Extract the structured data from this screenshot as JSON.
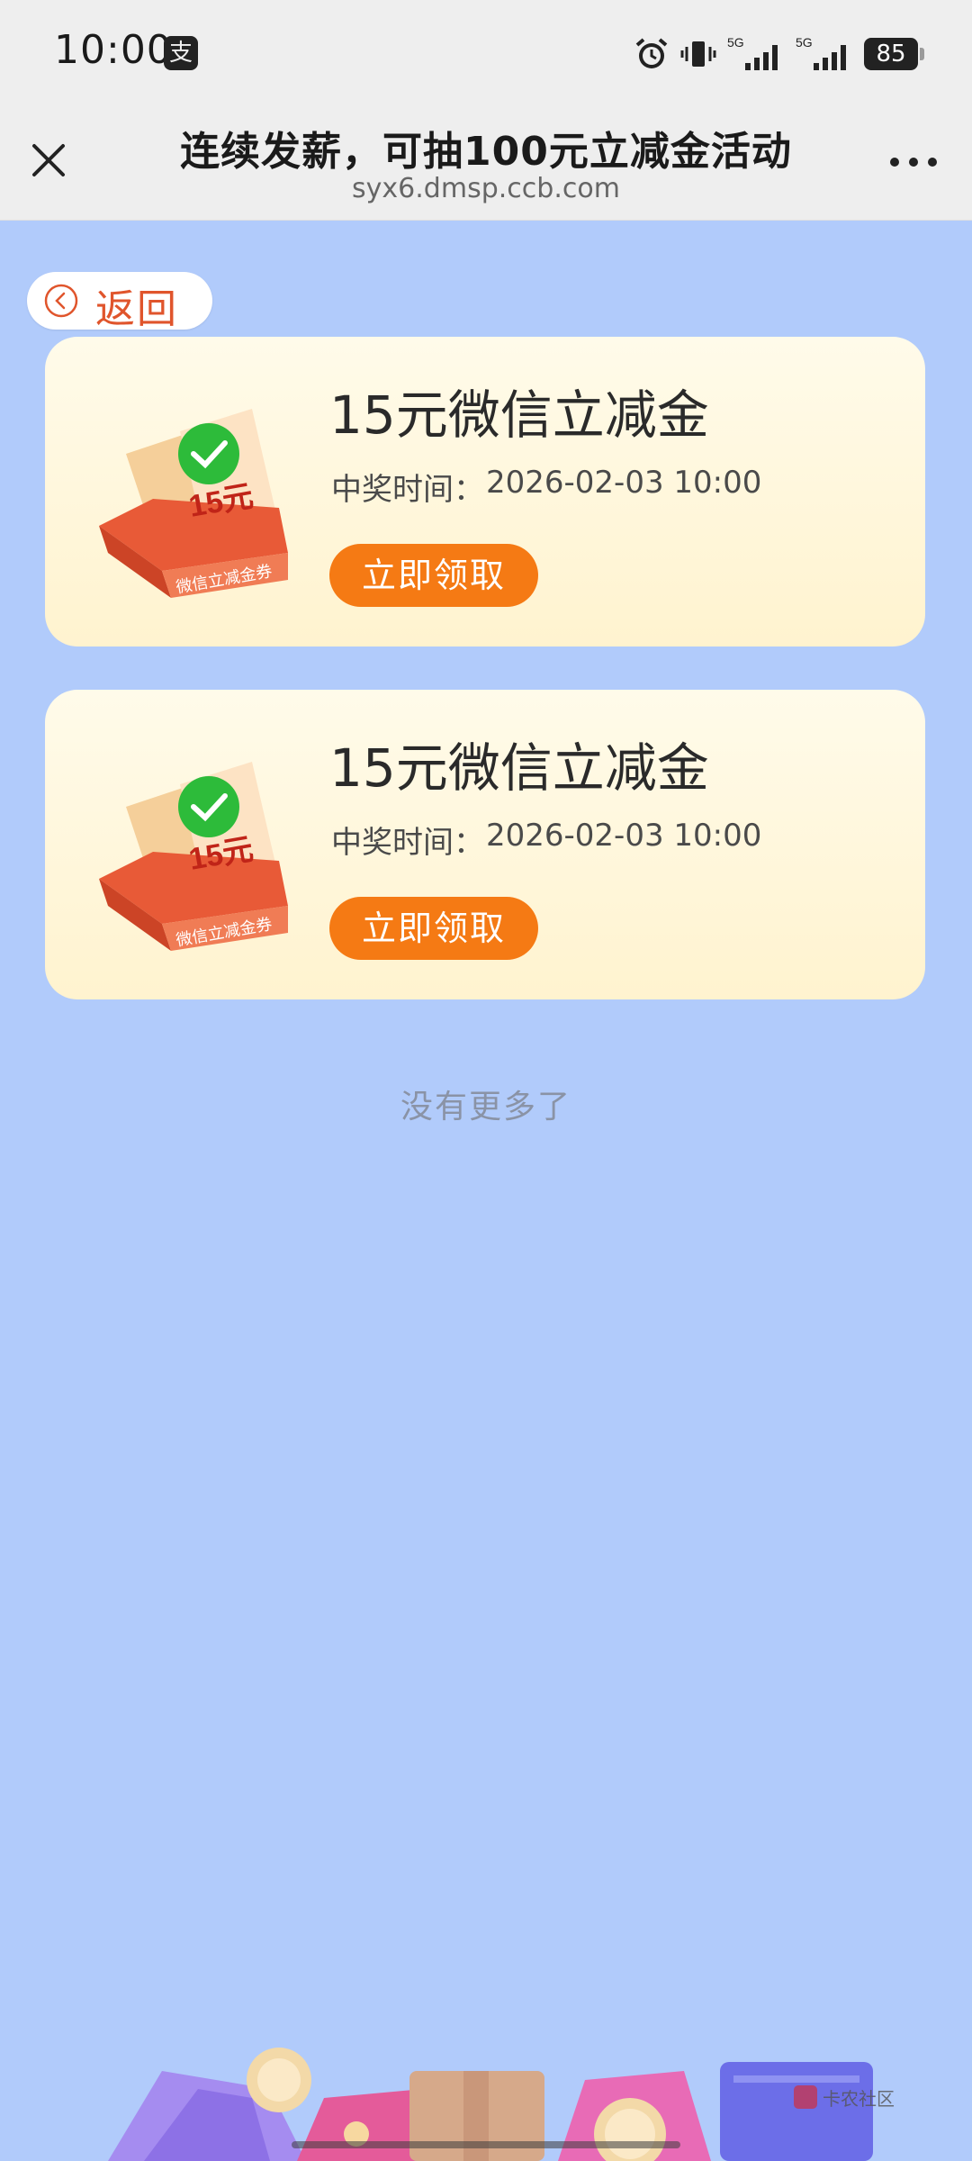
{
  "status_bar": {
    "time": "10:00",
    "app_icon": "支",
    "signal_label_1": "5G",
    "signal_label_2": "5G",
    "battery": "85"
  },
  "title_bar": {
    "title": "连续发薪，可抽100元立减金活动",
    "url": "syx6.dmsp.ccb.com",
    "close_icon": "close-icon",
    "more_icon": "more-icon"
  },
  "back_button": {
    "label": "返回"
  },
  "coupon_art": {
    "amount": "15元",
    "caption": "微信立减金券"
  },
  "cards": [
    {
      "title": "15元微信立减金",
      "time_label": "中奖时间：",
      "time_value": "2026-02-03 10:00",
      "button": "立即领取"
    },
    {
      "title": "15元微信立减金",
      "time_label": "中奖时间：",
      "time_value": "2026-02-03 10:00",
      "button": "立即领取"
    }
  ],
  "footer": {
    "no_more": "没有更多了"
  },
  "watermark": {
    "text": "卡农社区"
  },
  "colors": {
    "page_bg": "#b1cbfb",
    "accent_orange": "#f57a14",
    "back_text": "#e0552c",
    "card_bg": "#fff3cf"
  }
}
